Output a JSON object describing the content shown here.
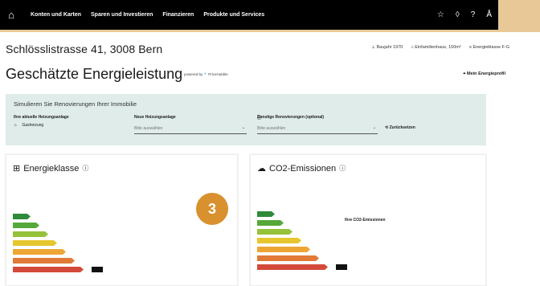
{
  "nav": {
    "items": [
      "Konten und Karten",
      "Sparen und Investieren",
      "Finanzieren",
      "Produkte und Services"
    ]
  },
  "property": {
    "address": "Schlösslistrasse 41, 3008 Bern",
    "build_year": "Baujahr 1970",
    "building_type": "Einfamilienhaus, 150m²",
    "energy_class": "Energieklasse F-G"
  },
  "page": {
    "title": "Geschätzte Energieleistung",
    "powered_by": "powered by",
    "powered_brand": "PriceHubble",
    "profile_link": "Mein Energieprofil"
  },
  "simulation": {
    "title": "Simulieren Sie Renovierungen Ihrer Immobilie",
    "current_label": "Ihre aktuelle Heizungsanlage",
    "current_value": "Gasheizung",
    "new_label": "Neue Heizungsanlage",
    "new_placeholder": "Bitte auswählen",
    "other_label": "Sonstige Renovierungen (optional)",
    "other_placeholder": "Bitte auswählen",
    "reset": "Zurücksetzen"
  },
  "energy_card": {
    "title": "Energieklasse",
    "text": "",
    "subheading": "",
    "desc": ""
  },
  "co2_card": {
    "title": "CO2-Emissionen",
    "text": "",
    "subheading": "Ihre CO2-Emissionen",
    "desc": ""
  },
  "badge": "3",
  "bars": {
    "colors": [
      "#2e8b3a",
      "#55a83a",
      "#95c23a",
      "#e6c62e",
      "#eda634",
      "#e07a36",
      "#d44a3a"
    ],
    "energy_rating_index": 6,
    "co2_rating_index": 6
  }
}
